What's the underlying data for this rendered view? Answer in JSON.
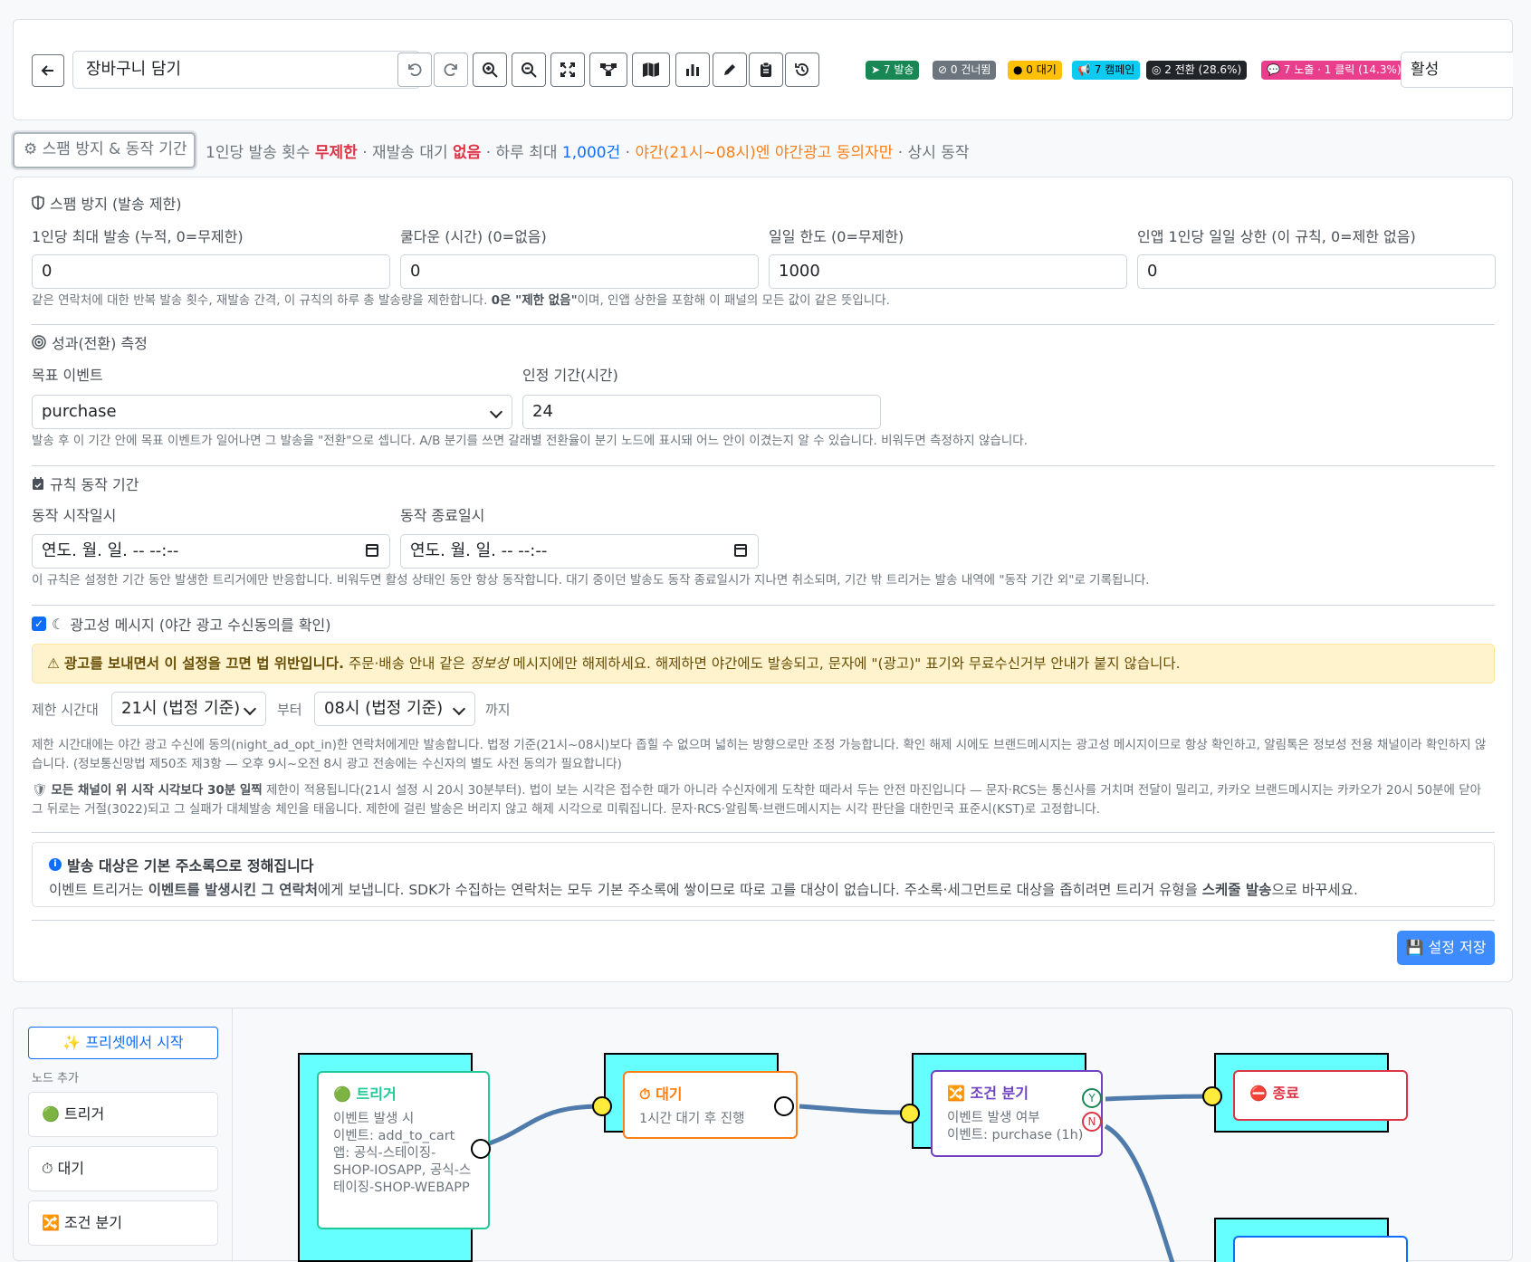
{
  "toolbar": {
    "title_value": "장바구니 담기",
    "badges": [
      {
        "label": "7 발송",
        "color": "#198754"
      },
      {
        "label": "0 건너뜀",
        "color": "#6c757d"
      },
      {
        "label": "0 대기",
        "color": "#ffc107"
      },
      {
        "label": "7 캠페인",
        "color": "#0dcaf0"
      },
      {
        "label": "2 전환 (28.6%)",
        "color": "#212529"
      },
      {
        "label": "7 노출 · 1 클릭 (14.3%)",
        "color": "#e83e8c"
      }
    ],
    "status_value": "활성",
    "buttons": [
      "back-icon",
      "undo-icon",
      "redo-icon",
      "zoom-in-icon",
      "zoom-out-icon",
      "fit-screen-icon",
      "auto-layout-icon",
      "minimap-icon",
      "stats-icon",
      "pen-icon",
      "clipboard-icon",
      "history-icon"
    ]
  },
  "summary": {
    "toggle_label": "스팸 방지 & 동작 기간",
    "p1": "1인당 발송 횟수 ",
    "v1": "무제한",
    "p2": " · 재발송 대기 ",
    "v2": "없음",
    "p3": " · 하루 최대 ",
    "v3": "1,000건",
    "p4": " · ",
    "v4": "야간(21시~08시)엔 야간광고 동의자만",
    "p5": " · 상시 동작"
  },
  "spam": {
    "title": "스팸 방지 (발송 제한)",
    "fields": [
      {
        "label": "1인당 최대 발송 (누적, 0=무제한)",
        "value": "0"
      },
      {
        "label": "쿨다운 (시간) (0=없음)",
        "value": "0"
      },
      {
        "label": "일일 한도 (0=무제한)",
        "value": "1000"
      },
      {
        "label": "인앱 1인당 일일 상한 (이 규칙, 0=제한 없음)",
        "value": "0"
      }
    ],
    "help_a": "같은 연락처에 대한 반복 발송 횟수, 재발송 간격, 이 규칙의 하루 총 발송량을 제한합니다. ",
    "help_b": "0은 \"제한 없음\"",
    "help_c": "이며, 인앱 상한을 포함해 이 패널의 모든 값이 같은 뜻입니다."
  },
  "conversion": {
    "title": "성과(전환) 측정",
    "goal_label": "목표 이벤트",
    "goal_value": "purchase",
    "window_label": "인정 기간(시간)",
    "window_value": "24",
    "help": "발송 후 이 기간 안에 목표 이벤트가 일어나면 그 발송을 \"전환\"으로 셉니다. A/B 분기를 쓰면 갈래별 전환율이 분기 노드에 표시돼 어느 안이 이겼는지 알 수 있습니다. 비워두면 측정하지 않습니다."
  },
  "period": {
    "title": "규칙 동작 기간",
    "start_label": "동작 시작일시",
    "start_value": "연도. 월. 일. -- --:--",
    "end_label": "동작 종료일시",
    "end_value": "연도. 월. 일. -- --:--",
    "help": "이 규칙은 설정한 기간 동안 발생한 트리거에만 반응합니다. 비워두면 활성 상태인 동안 항상 동작합니다. 대기 중이던 발송도 동작 종료일시가 지나면 취소되며, 기간 밖 트리거는 발송 내역에 \"동작 기간 외\"로 기록됩니다."
  },
  "ad": {
    "checkbox_label": "광고성 메시지 (야간 광고 수신동의를 확인)",
    "warn_bold": "광고를 보내면서 이 설정을 끄면 법 위반입니다.",
    "warn_a": " 주문·배송 안내 같은 ",
    "warn_em": "정보성",
    "warn_b": " 메시지에만 해제하세요. 해제하면 야간에도 발송되고, 문자에 \"(광고)\" 표기와 무료수신거부 안내가 붙지 않습니다.",
    "range_label": "제한 시간대",
    "from_value": "21시 (법정 기준)",
    "from_suffix": "부터",
    "to_value": "08시 (법정 기준)",
    "to_suffix": "까지",
    "help1": "제한 시간대에는 야간 광고 수신에 동의(night_ad_opt_in)한 연락처에게만 발송합니다. 법정 기준(21시~08시)보다 좁힐 수 없으며 넓히는 방향으로만 조정 가능합니다. 확인 해제 시에도 브랜드메시지는 광고성 메시지이므로 항상 확인하고, 알림톡은 정보성 전용 채널이라 확인하지 않습니다. (정보통신망법 제50조 제3항 — 오후 9시~오전 8시 광고 전송에는 수신자의 별도 사전 동의가 필요합니다)",
    "help2_bold": "모든 채널이 위 시작 시각보다 30분 일찍",
    "help2": " 제한이 적용됩니다(21시 설정 시 20시 30분부터). 법이 보는 시각은 접수한 때가 아니라 수신자에게 도착한 때라서 두는 안전 마진입니다 — 문자·RCS는 통신사를 거치며 전달이 밀리고, 카카오 브랜드메시지는 카카오가 20시 50분에 닫아 그 뒤로는 거절(3022)되고 그 실패가 대체발송 체인을 태웁니다. 제한에 걸린 발송은 버리지 않고 해제 시각으로 미뤄집니다. 문자·RCS·알림톡·브랜드메시지는 시각 판단을 대한민국 표준시(KST)로 고정합니다."
  },
  "target": {
    "title": "발송 대상은 기본 주소록으로 정해집니다",
    "t1": "이벤트 트리거는 ",
    "b1": "이벤트를 발생시킨 그 연락처",
    "t2": "에게 보냅니다. SDK가 수집하는 연락처는 모두 기본 주소록에 쌓이므로 따로 고를 대상이 없습니다. 주소록·세그먼트로 대상을 좁히려면 트리거 유형을 ",
    "b2": "스케줄 발송",
    "t3": "으로 바꾸세요."
  },
  "save_label": "설정 저장",
  "builder": {
    "preset_label": "프리셋에서 시작",
    "node_add_label": "노드 추가",
    "palette": [
      {
        "icon": "🟢",
        "label": "트리거"
      },
      {
        "icon": "⏱",
        "label": "대기"
      },
      {
        "icon": "🔀",
        "label": "조건 분기"
      }
    ],
    "nodes": {
      "trigger": {
        "title": "트리거",
        "icon": "🟢",
        "color": "#20c997",
        "lines": [
          "이벤트 발생 시",
          "이벤트: add_to_cart",
          "앱: 공식-스테이징-SHOP-IOSAPP, 공식-스테이징-SHOP-WEBAPP"
        ]
      },
      "wait": {
        "title": "대기",
        "icon": "⏱",
        "color": "#fd7e14",
        "lines": [
          "1시간 대기 후 진행"
        ]
      },
      "branch": {
        "title": "조건 분기",
        "icon": "🔀",
        "color": "#6f42c1",
        "lines": [
          "이벤트 발생 여부",
          "이벤트: purchase (1h)"
        ]
      },
      "end": {
        "title": "종료",
        "icon": "⛔",
        "color": "#dc3545"
      }
    },
    "yes_label": "Y",
    "no_label": "N"
  }
}
